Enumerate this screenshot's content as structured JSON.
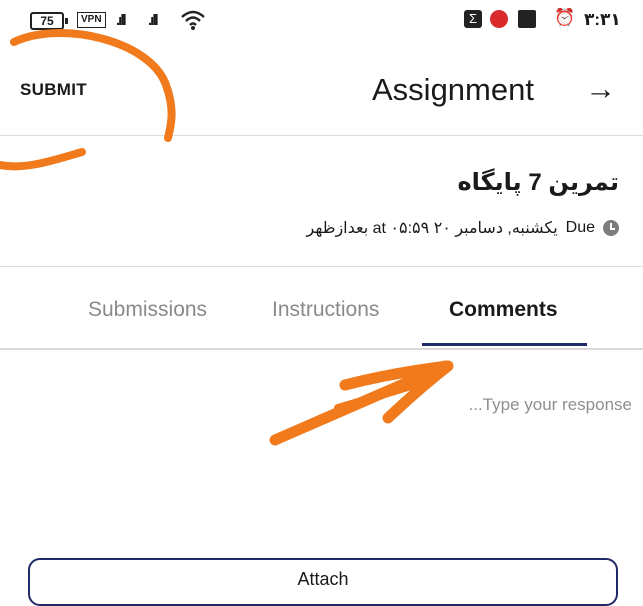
{
  "status_bar": {
    "battery": "75",
    "vpn": "VPN",
    "time": "۳:۳۱",
    "signal_icon": "signal-icon",
    "wifi_icon": "wifi-icon"
  },
  "header": {
    "submit_label": "SUBMIT",
    "title": "Assignment",
    "forward_icon": "→"
  },
  "assignment": {
    "name": "تمرین 7 پایگاه",
    "due_label": "Due",
    "due_text": "یکشنبه, دسامبر ۲۰ at ۰۵:۵۹ بعدازظهر"
  },
  "tabs": [
    {
      "label": "Submissions",
      "active": false
    },
    {
      "label": "Instructions",
      "active": false
    },
    {
      "label": "Comments",
      "active": true
    }
  ],
  "comment": {
    "placeholder": "...Type your response",
    "value": ""
  },
  "attach": {
    "label": "Attach"
  },
  "colors": {
    "accent": "#1f2a66",
    "annotation": "#f07a1c"
  }
}
